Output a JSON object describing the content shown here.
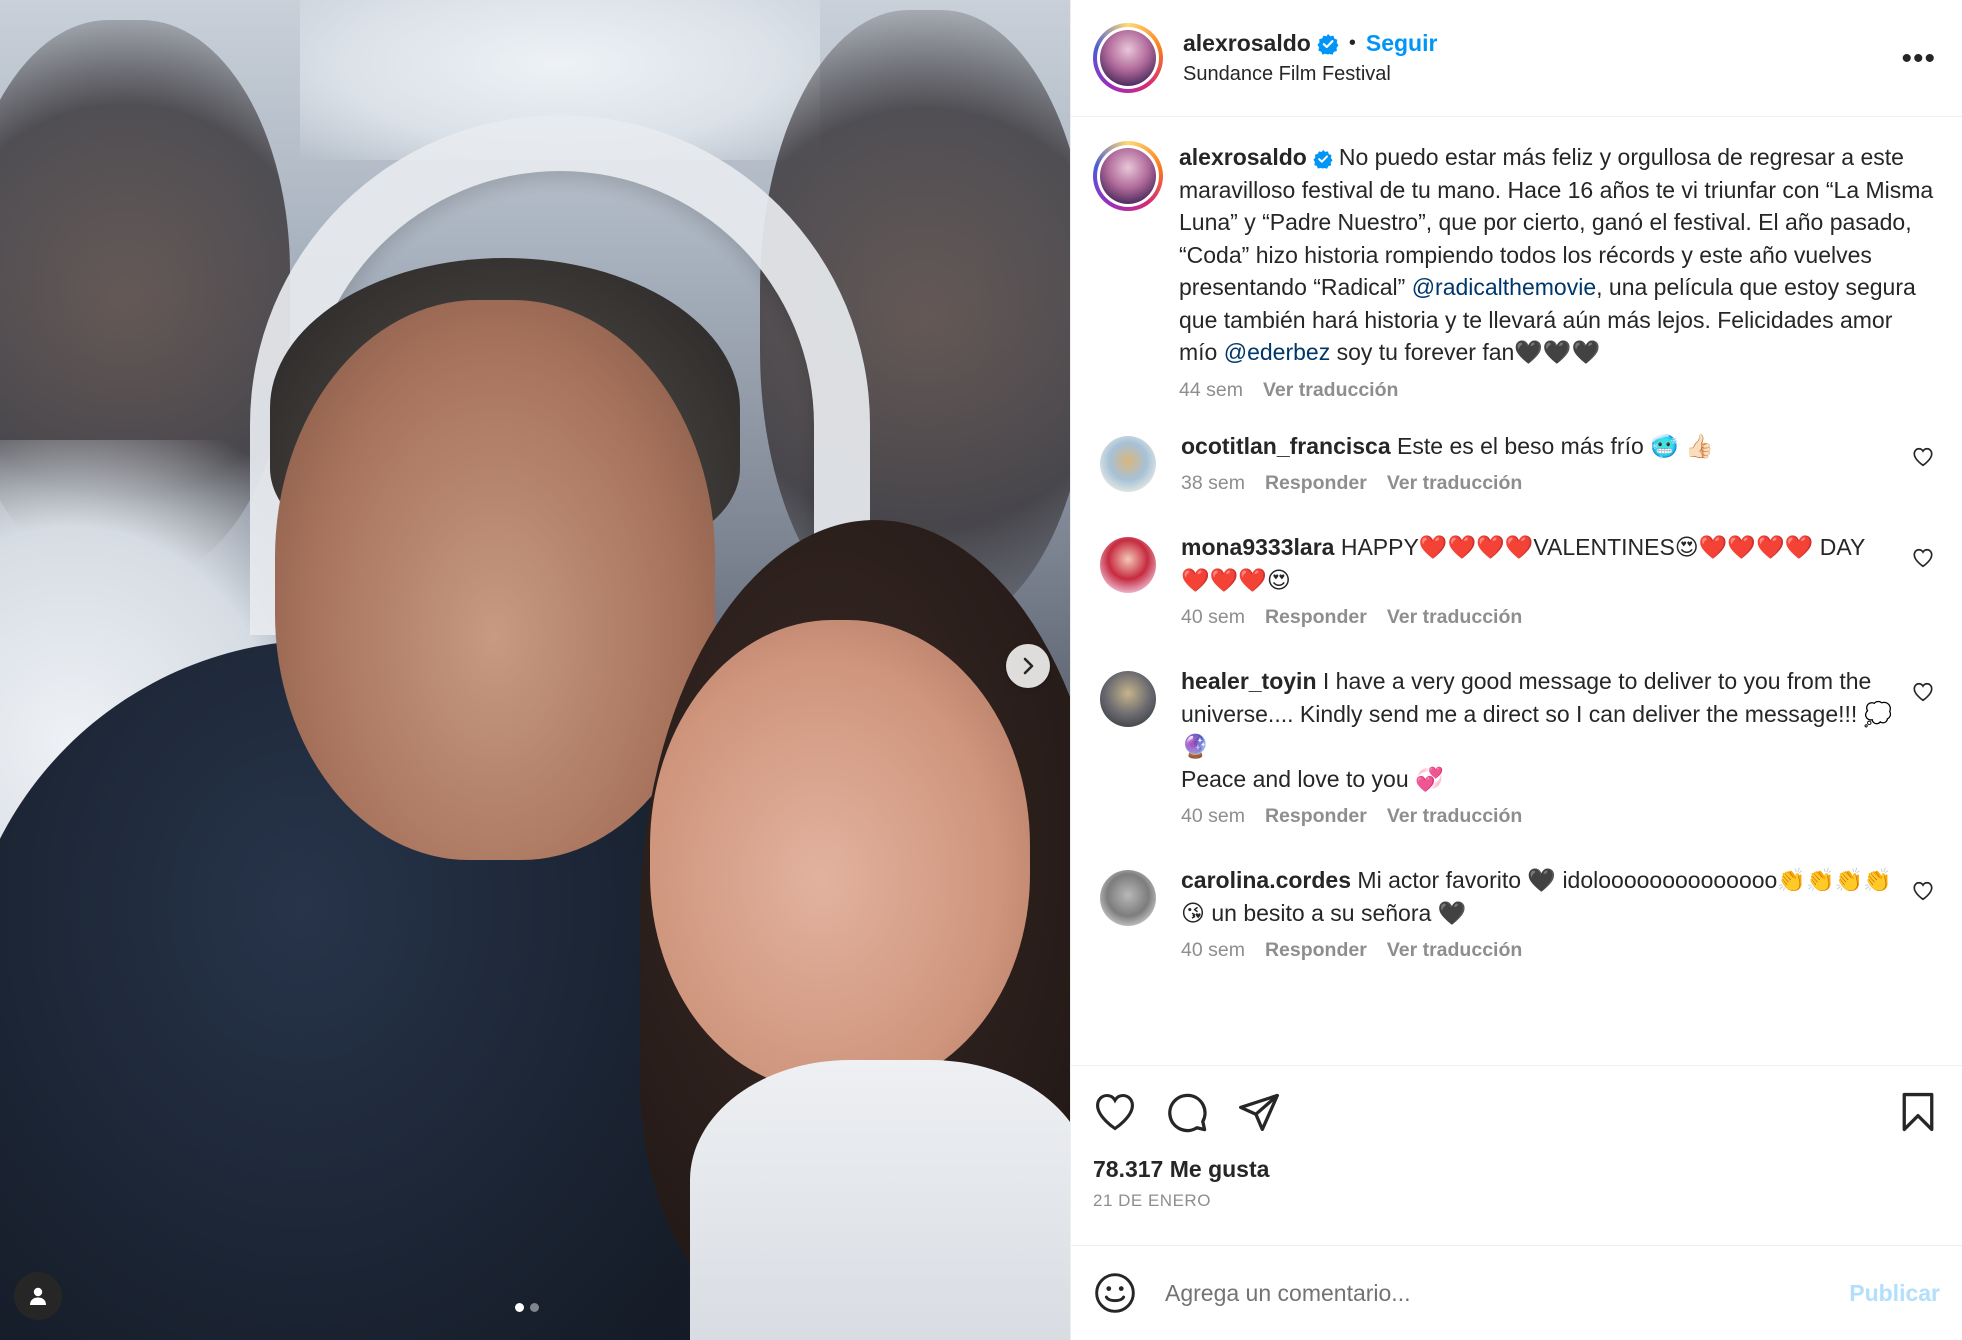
{
  "post": {
    "author": "alexrosaldo",
    "location": "Sundance Film Festival",
    "follow_label": "Seguir",
    "bullet": "•",
    "more_label": "•••"
  },
  "caption": {
    "username": "alexrosaldo",
    "text_1": "No puedo estar más feliz y orgullosa de regresar a este maravilloso festival de tu mano. Hace 16 años te vi triunfar con “La Misma Luna” y “Padre Nuestro”, que por cierto, ganó el festival. El año pasado, “Coda” hizo historia rompiendo todos los récords y este año vuelves presentando “Radical” ",
    "mention_1": "@radicalthemovie",
    "text_2": ", una película que estoy segura que también hará historia y te llevará aún más lejos. Felicidades amor mío ",
    "mention_2": "@ederbez",
    "text_3": " soy tu forever fan🖤🖤🖤",
    "time": "44 sem",
    "translate": "Ver traducción"
  },
  "comments": [
    {
      "username": "ocotitlan_francisca",
      "text": "Este es el beso más frío 🥶 👍🏻",
      "time": "38 sem",
      "reply": "Responder",
      "translate": "Ver traducción"
    },
    {
      "username": "mona9333lara",
      "text": "HAPPY❤️❤️❤️❤️VALENTINES😍❤️❤️❤️❤️ DAY ❤️❤️❤️😍",
      "time": "40 sem",
      "reply": "Responder",
      "translate": "Ver traducción"
    },
    {
      "username": "healer_toyin",
      "text": "I have a very good message to deliver to you from the universe.... Kindly send me a direct so I can deliver the message!!! 💭🔮",
      "text_line2": "Peace and love to you 💞",
      "time": "40 sem",
      "reply": "Responder",
      "translate": "Ver traducción"
    },
    {
      "username": "carolina.cordes",
      "text": "Mi actor favorito 🖤 idoloooooooooooooo👏👏👏👏😘 un besito a su señora 🖤",
      "time": "40 sem",
      "reply": "Responder",
      "translate": "Ver traducción"
    }
  ],
  "footer": {
    "likes": "78.317 Me gusta",
    "date": "21 DE ENERO",
    "comment_placeholder": "Agrega un comentario...",
    "publish_label": "Publicar"
  },
  "carousel": {
    "slides": 2,
    "current": 1
  },
  "colors": {
    "link": "#0095f6",
    "mention": "#00376b",
    "muted": "#8e8e8e",
    "verified": "#0095f6"
  },
  "icons": [
    "verified-badge-icon",
    "more-options-icon",
    "heart-icon",
    "comment-icon",
    "share-icon",
    "bookmark-icon",
    "emoji-icon",
    "chevron-right-icon",
    "user-tag-icon"
  ]
}
